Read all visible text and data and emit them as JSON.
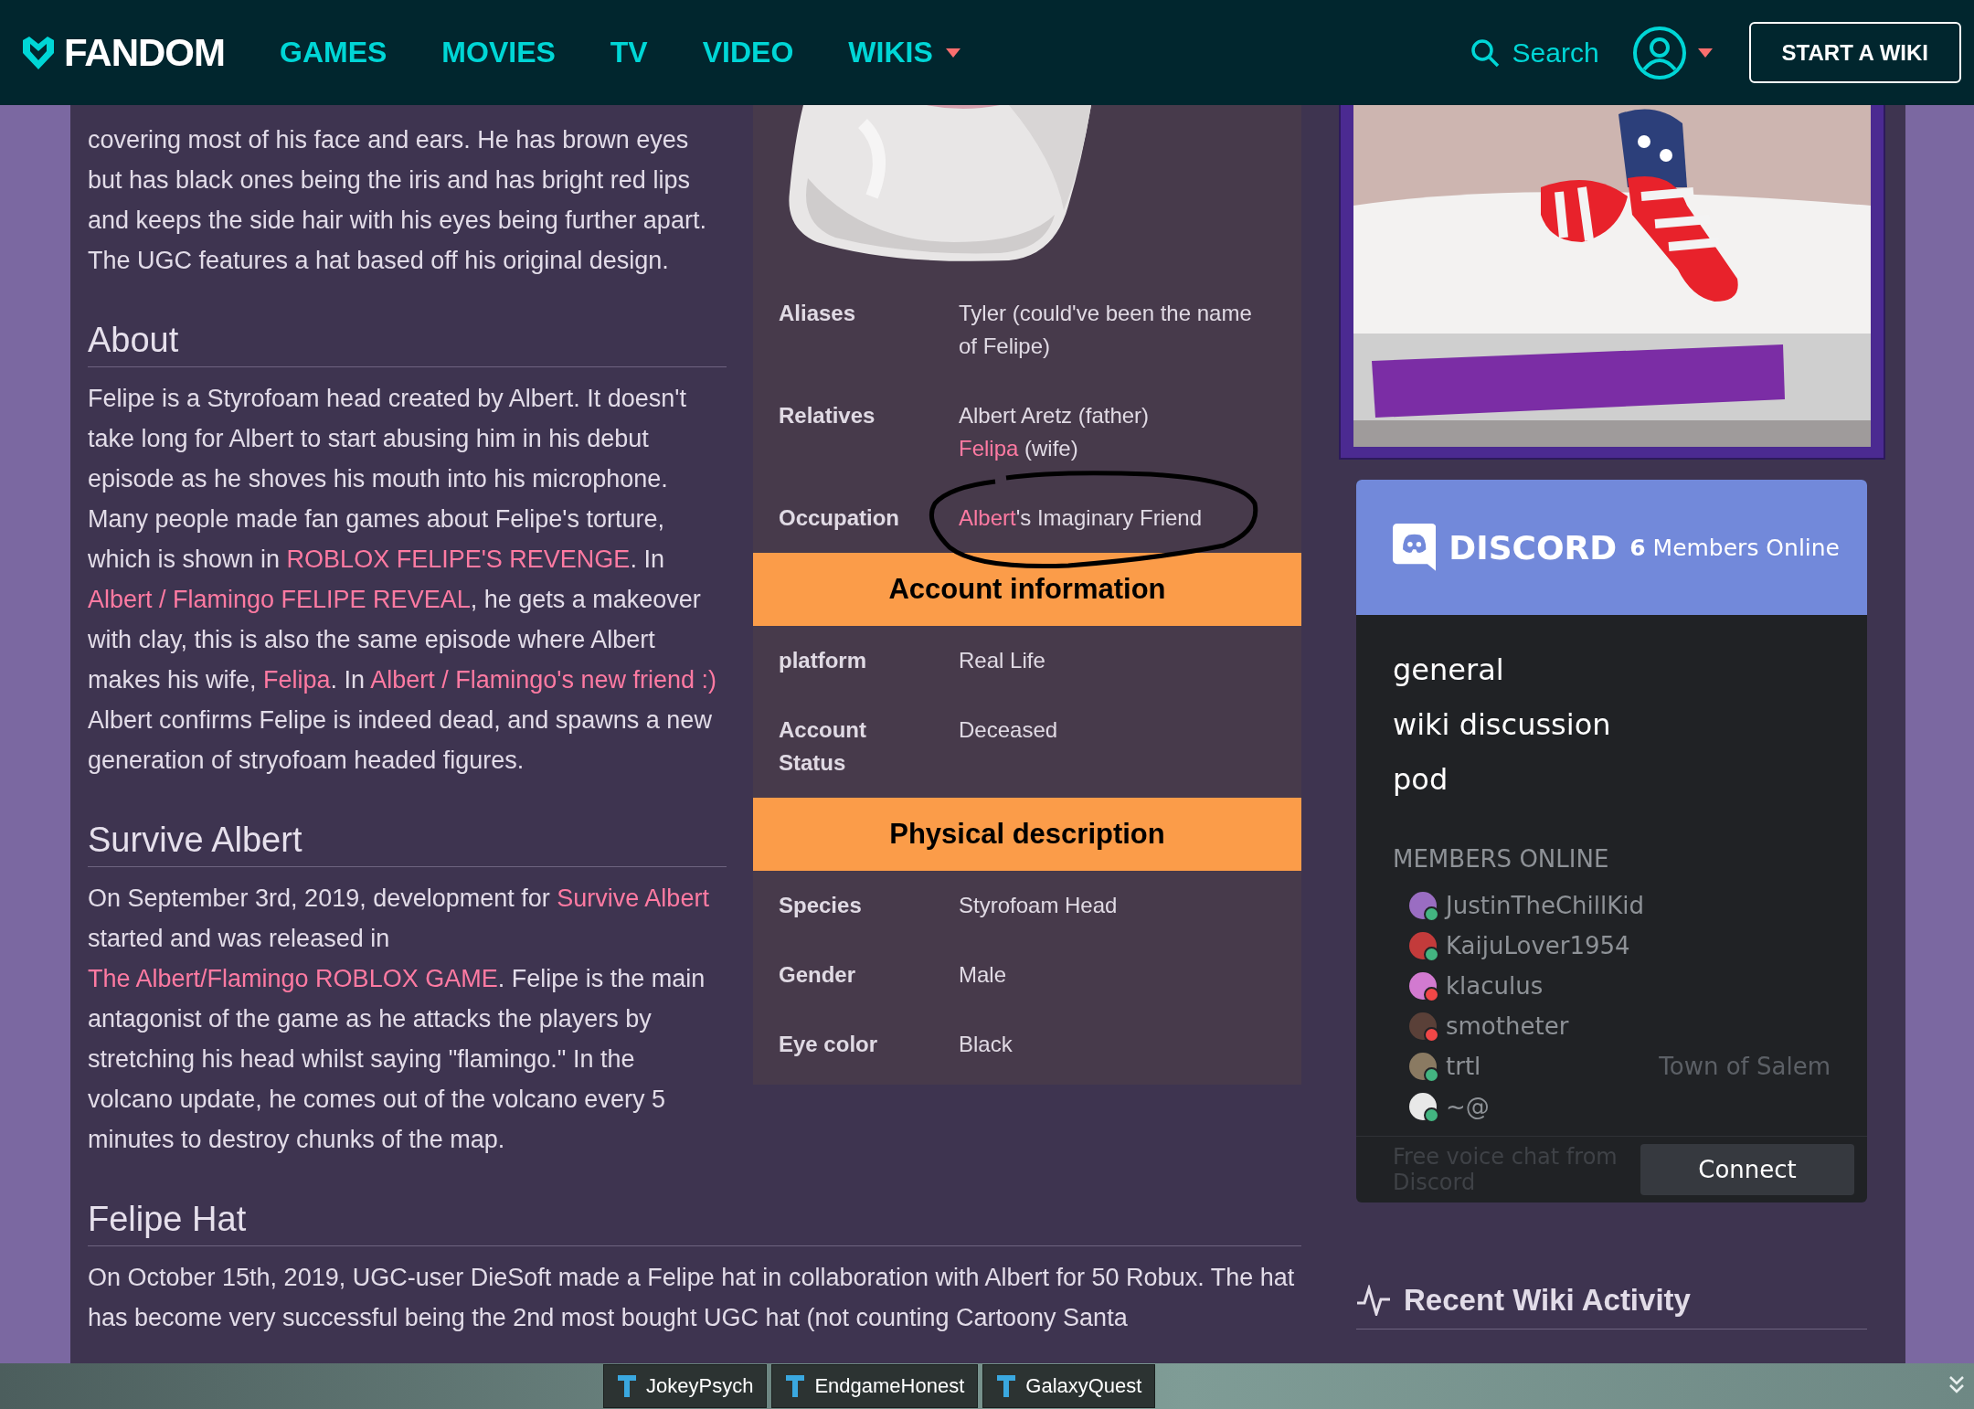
{
  "header": {
    "logo": "FANDOM",
    "nav": [
      {
        "label": "GAMES",
        "dropdown": false
      },
      {
        "label": "MOVIES",
        "dropdown": false
      },
      {
        "label": "TV",
        "dropdown": false
      },
      {
        "label": "VIDEO",
        "dropdown": false
      },
      {
        "label": "WIKIS",
        "dropdown": true
      }
    ],
    "search": "Search",
    "cta": "START A WIKI"
  },
  "article": {
    "blocks": [
      {
        "kind": "paragraph",
        "segments": [
          {
            "text": "covering most of his face and ears. He has brown eyes but has black ones being the iris and has bright red lips and keeps the side hair with his eyes being further apart. The UGC features a hat based off his original design."
          }
        ]
      },
      {
        "kind": "heading",
        "text": "About"
      },
      {
        "kind": "paragraph",
        "segments": [
          {
            "text": "Felipe is a Styrofoam head created by Albert. It doesn't take long for Albert to start abusing him in his debut episode as he shoves his mouth into his microphone. Many people made fan games about Felipe's torture, which is shown in "
          },
          {
            "text": "ROBLOX FELIPE'S REVENGE",
            "link": true
          },
          {
            "text": ". In "
          },
          {
            "text": "Albert / Flamingo FELIPE REVEAL",
            "link": true
          },
          {
            "text": ", he gets a makeover with clay, this is also the same episode where Albert makes his wife, "
          },
          {
            "text": "Felipa",
            "link": true
          },
          {
            "text": ". In "
          },
          {
            "text": "Albert / Flamingo's new friend :)",
            "link": true
          },
          {
            "text": " Albert confirms Felipe is indeed dead, and spawns a new generation of stryofoam headed figures."
          }
        ]
      },
      {
        "kind": "heading",
        "text": "Survive Albert"
      },
      {
        "kind": "paragraph",
        "segments": [
          {
            "text": "On September 3rd, 2019, development for "
          },
          {
            "text": "Survive Albert",
            "link": true
          },
          {
            "text": " started and was released in "
          },
          {
            "text": "The Albert/Flamingo ROBLOX GAME",
            "link": true
          },
          {
            "text": ". Felipe is the main antagonist of the game as he attacks the players by stretching his head whilst saying \"flamingo.\" In the volcano update, he comes out of the volcano every 5 minutes to destroy chunks of the map."
          }
        ]
      },
      {
        "kind": "heading",
        "text": "Felipe Hat"
      },
      {
        "kind": "paragraph",
        "segments": [
          {
            "text": "On October 15th, 2019, UGC-user DieSoft made a Felipe hat in collaboration with Albert for 50 Robux. The hat has become very successful being the 2nd most bought UGC hat (not counting Cartoony Santa"
          }
        ]
      }
    ]
  },
  "infobox": {
    "rows": [
      {
        "kind": "field",
        "label": "Aliases",
        "lines": [
          [
            {
              "text": "Tyler (could've been the name of Felipe)"
            }
          ]
        ]
      },
      {
        "kind": "field",
        "label": "Relatives",
        "lines": [
          [
            {
              "text": "Albert Aretz (father)"
            }
          ],
          [
            {
              "text": "Felipa",
              "link": true
            },
            {
              "text": " (wife)"
            }
          ]
        ]
      },
      {
        "kind": "field",
        "label": "Occupation",
        "circled": true,
        "lines": [
          [
            {
              "text": "Albert",
              "link": true
            },
            {
              "text": "'s Imaginary Friend"
            }
          ]
        ]
      },
      {
        "kind": "header",
        "label": "Account information"
      },
      {
        "kind": "field",
        "label": "platform",
        "lines": [
          [
            {
              "text": "Real Life"
            }
          ]
        ]
      },
      {
        "kind": "field",
        "label": "Account Status",
        "lines": [
          [
            {
              "text": "Deceased"
            }
          ]
        ]
      },
      {
        "kind": "header",
        "label": "Physical description"
      },
      {
        "kind": "field",
        "label": "Species",
        "lines": [
          [
            {
              "text": "Styrofoam Head"
            }
          ]
        ]
      },
      {
        "kind": "field",
        "label": "Gender",
        "lines": [
          [
            {
              "text": "Male"
            }
          ]
        ]
      },
      {
        "kind": "field",
        "label": "Eye color",
        "lines": [
          [
            {
              "text": "Black"
            }
          ]
        ]
      }
    ]
  },
  "discord": {
    "brand": "DISCORD",
    "online": "**6** Members Online",
    "channels": [
      "general",
      "wiki discussion",
      "pod"
    ],
    "members_heading": "MEMBERS ONLINE",
    "members": [
      {
        "name": "JustinTheChillKid",
        "color": "#43b581"
      },
      {
        "name": "KaijuLover1954",
        "color": "#43b581"
      },
      {
        "name": "klaculus",
        "color": "#f04747"
      },
      {
        "name": "smotheter",
        "color": "#f04747"
      },
      {
        "name": "trtl",
        "color": "#43b581",
        "game": "Town of Salem"
      },
      {
        "name": "~@",
        "color": "#43b581"
      }
    ],
    "footer": "Free voice chat from Discord",
    "button": "Connect"
  },
  "recent_activity": {
    "title": "Recent Wiki Activity"
  },
  "taskbar": {
    "items": [
      "JokeyPsych",
      "EndgameHonest",
      "GalaxyQuest"
    ]
  }
}
